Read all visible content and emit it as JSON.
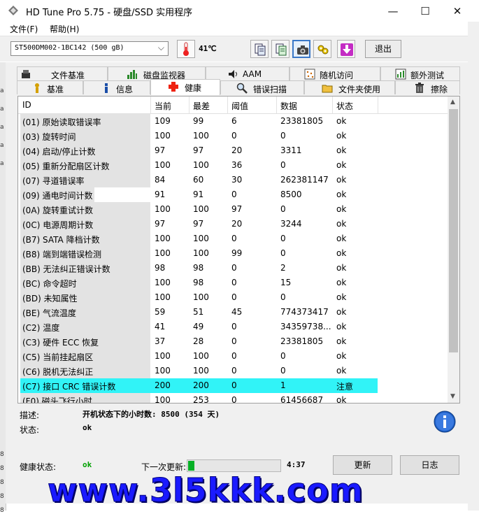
{
  "window": {
    "title": "HD Tune Pro 5.75 - 硬盘/SSD 实用程序",
    "minimize": "—",
    "maximize": "☐",
    "close": "✕"
  },
  "menu": [
    {
      "label": "文件(F)"
    },
    {
      "label": "帮助(H)"
    }
  ],
  "toolbar": {
    "drive": "ST500DM002-1BC142 (500 gB)",
    "drive_arrow": "⌵",
    "temperature": "41℃",
    "buttons": [
      {
        "icon": "copy-info-icon"
      },
      {
        "icon": "copy-text-icon"
      },
      {
        "icon": "screenshot-camera-icon"
      },
      {
        "icon": "options-icon"
      },
      {
        "icon": "save-down-arrow-icon"
      }
    ],
    "exit_label": "退出"
  },
  "tabs_row1": [
    {
      "label": "文件基准",
      "icon": "file-benchmark-icon"
    },
    {
      "label": "磁盘监视器",
      "icon": "disk-monitor-icon"
    },
    {
      "label": "AAM",
      "icon": "speaker-icon"
    },
    {
      "label": "随机访问",
      "icon": "random-access-icon"
    },
    {
      "label": "额外测试",
      "icon": "extra-tests-icon"
    }
  ],
  "tabs_row2": [
    {
      "label": "基准",
      "icon": "benchmark-icon"
    },
    {
      "label": "信息",
      "icon": "info-icon"
    },
    {
      "label": "健康",
      "icon": "health-cross-icon"
    },
    {
      "label": "错误扫描",
      "icon": "error-scan-icon"
    },
    {
      "label": "文件夹使用",
      "icon": "folder-icon"
    },
    {
      "label": "擦除",
      "icon": "erase-icon"
    }
  ],
  "table": {
    "headers": [
      "ID",
      "当前",
      "最差",
      "阈值",
      "数据",
      "状态"
    ],
    "rows": [
      [
        "(01) 原始读取错误率",
        "109",
        "99",
        "6",
        "23381805",
        "ok"
      ],
      [
        "(03) 旋转时间",
        "100",
        "100",
        "0",
        "0",
        "ok"
      ],
      [
        "(04) 启动/停止计数",
        "97",
        "97",
        "20",
        "3311",
        "ok"
      ],
      [
        "(05) 重新分配扇区计数",
        "100",
        "100",
        "36",
        "0",
        "ok"
      ],
      [
        "(07) 寻道错误率",
        "84",
        "60",
        "30",
        "262381147",
        "ok"
      ],
      [
        "(09) 通电时间计数",
        "91",
        "91",
        "0",
        "8500",
        "ok"
      ],
      [
        "(0A) 旋转重试计数",
        "100",
        "100",
        "97",
        "0",
        "ok"
      ],
      [
        "(0C) 电源周期计数",
        "97",
        "97",
        "20",
        "3244",
        "ok"
      ],
      [
        "(B7) SATA 降档计数",
        "100",
        "100",
        "0",
        "0",
        "ok"
      ],
      [
        "(B8) 端到端错误检测",
        "100",
        "100",
        "99",
        "0",
        "ok"
      ],
      [
        "(BB) 无法纠正错误计数",
        "98",
        "98",
        "0",
        "2",
        "ok"
      ],
      [
        "(BC) 命令超时",
        "100",
        "98",
        "0",
        "15",
        "ok"
      ],
      [
        "(BD) 未知属性",
        "100",
        "100",
        "0",
        "0",
        "ok"
      ],
      [
        "(BE) 气流温度",
        "59",
        "51",
        "45",
        "774373417",
        "ok"
      ],
      [
        "(C2) 温度",
        "41",
        "49",
        "0",
        "34359738...",
        "ok"
      ],
      [
        "(C3) 硬件 ECC 恢复",
        "37",
        "28",
        "0",
        "23381805",
        "ok"
      ],
      [
        "(C5) 当前挂起扇区",
        "100",
        "100",
        "0",
        "0",
        "ok"
      ],
      [
        "(C6) 脱机无法纠正",
        "100",
        "100",
        "0",
        "0",
        "ok"
      ],
      [
        "(C7) 接口 CRC 错误计数",
        "200",
        "200",
        "0",
        "1",
        "注意"
      ],
      [
        "(F0) 磁头飞行小时",
        "100",
        "253",
        "0",
        "61456687",
        "ok"
      ]
    ],
    "highlight_color": "#31f3f7"
  },
  "details": {
    "desc_label": "描述:",
    "desc_value": "开机状态下的小时数: 8500 (354 天)",
    "status_label": "状态:",
    "status_value": "ok"
  },
  "footer": {
    "health_label": "健康状态:",
    "health_value": "ok",
    "next_update_label": "下一次更新:",
    "progress_fraction": 0.07,
    "countdown": "4:37",
    "refresh_label": "更新",
    "log_label": "日志"
  },
  "watermark": "www.3l5kkk.com",
  "sidebar_marks": [
    "a",
    "a",
    "a",
    "a",
    "a",
    "8",
    "8",
    "8",
    "8",
    "8"
  ]
}
